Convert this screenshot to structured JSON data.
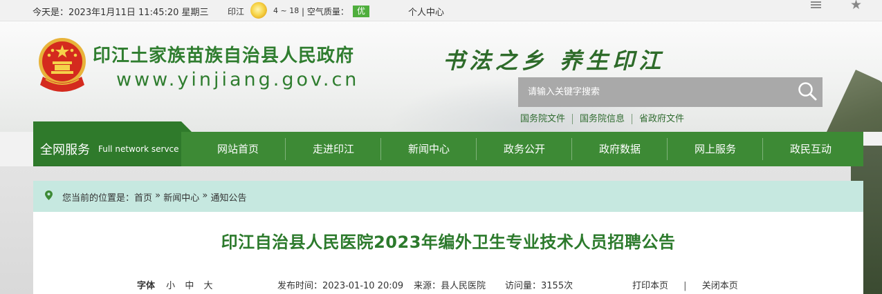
{
  "topbar": {
    "date": "今天是：2023年1月11日 11:45:20 星期三",
    "city": "印江",
    "temperature": "4 ~ 18",
    "air_label": "| 空气质量：",
    "air_quality": "优",
    "personal_center": "个人中心"
  },
  "header": {
    "site_title": "印江土家族苗族自治县人民政府",
    "domain": "www.yinjiang.gov.cn",
    "slogan": "书法之乡  养生印江",
    "search_placeholder": "请输入关键字搜索",
    "quick_links": [
      "国务院文件",
      "国务院信息",
      "省政府文件"
    ]
  },
  "nav": {
    "service_cn": "全网服务",
    "service_en": "Full network servce",
    "items": [
      "网站首页",
      "走进印江",
      "新闻中心",
      "政务公开",
      "政府数据",
      "网上服务",
      "政民互动"
    ]
  },
  "breadcrumb": {
    "prefix": "您当前的位置是：",
    "path": [
      "首页",
      "新闻中心",
      "通知公告"
    ],
    "separator": " » "
  },
  "article": {
    "title": "印江自治县人民医院2023年编外卫生专业技术人员招聘公告",
    "font_label": "字体",
    "font_sizes": [
      "小",
      "中",
      "大"
    ],
    "publish_time": "发布时间：2023-01-10 20:09",
    "source": "来源：县人民医院",
    "views": "访问量：3155次",
    "print": "打印本页",
    "divider": "|",
    "close": "关闭本页"
  },
  "colors": {
    "brand_green": "#3d8a35",
    "title_green": "#2c7a2c",
    "breadcrumb_bg": "#c6e8e0",
    "air_badge": "#4fae3d"
  }
}
